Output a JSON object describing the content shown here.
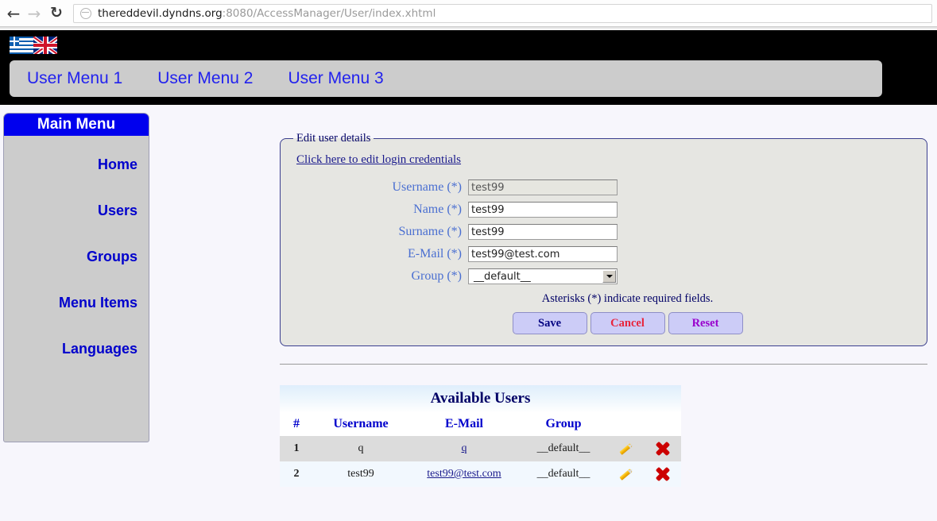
{
  "browser": {
    "back_icon": "back-arrow-icon",
    "forward_icon": "forward-arrow-icon",
    "reload_icon": "reload-icon",
    "favicon": "globe-icon",
    "url_host": "thereddevil.dyndns.org",
    "url_path": ":8080/AccessManager/User/index.xhtml"
  },
  "banner": {
    "flags": [
      {
        "name": "greek-flag",
        "label": "Greek"
      },
      {
        "name": "uk-flag",
        "label": "English"
      }
    ],
    "menu": [
      {
        "label": "User Menu 1"
      },
      {
        "label": "User Menu 2"
      },
      {
        "label": "User Menu 3"
      }
    ]
  },
  "sidebar": {
    "title": "Main Menu",
    "items": [
      {
        "label": "Home"
      },
      {
        "label": "Users"
      },
      {
        "label": "Groups"
      },
      {
        "label": "Menu Items"
      },
      {
        "label": "Languages"
      }
    ]
  },
  "form": {
    "legend": "Edit user details",
    "credentials_link": "Click here to edit login credentials",
    "fields": [
      {
        "label": "Username",
        "marker": "(*)",
        "value": "test99",
        "disabled": true
      },
      {
        "label": "Name",
        "marker": "(*)",
        "value": "test99",
        "disabled": false
      },
      {
        "label": "Surname",
        "marker": "(*)",
        "value": "test99",
        "disabled": false
      },
      {
        "label": "E-Mail",
        "marker": "(*)",
        "value": "test99@test.com",
        "disabled": false
      }
    ],
    "group": {
      "label": "Group",
      "marker": "(*)",
      "value": "__default__",
      "options": [
        "__default__"
      ]
    },
    "note": "Asterisks (*) indicate required fields.",
    "buttons": {
      "save": "Save",
      "cancel": "Cancel",
      "reset": "Reset"
    }
  },
  "table": {
    "caption": "Available Users",
    "columns": [
      "#",
      "Username",
      "E-Mail",
      "Group",
      "",
      ""
    ],
    "rows": [
      {
        "idx": "1",
        "username": "q",
        "email": "q",
        "group": "__default__"
      },
      {
        "idx": "2",
        "username": "test99",
        "email": "test99@test.com",
        "group": "__default__"
      }
    ]
  },
  "colors": {
    "banner": "#000000",
    "menu_link": "#2222ee",
    "sidebar_head": "#0000ee",
    "sidebar_bg": "#cccccc",
    "fieldset_border": "#3b3f8f",
    "button_bg": "#ccccf7",
    "save_text": "#000080",
    "cancel_text": "#e8253c",
    "reset_text": "#9900cc",
    "page_bg": "#f7f6fc"
  }
}
